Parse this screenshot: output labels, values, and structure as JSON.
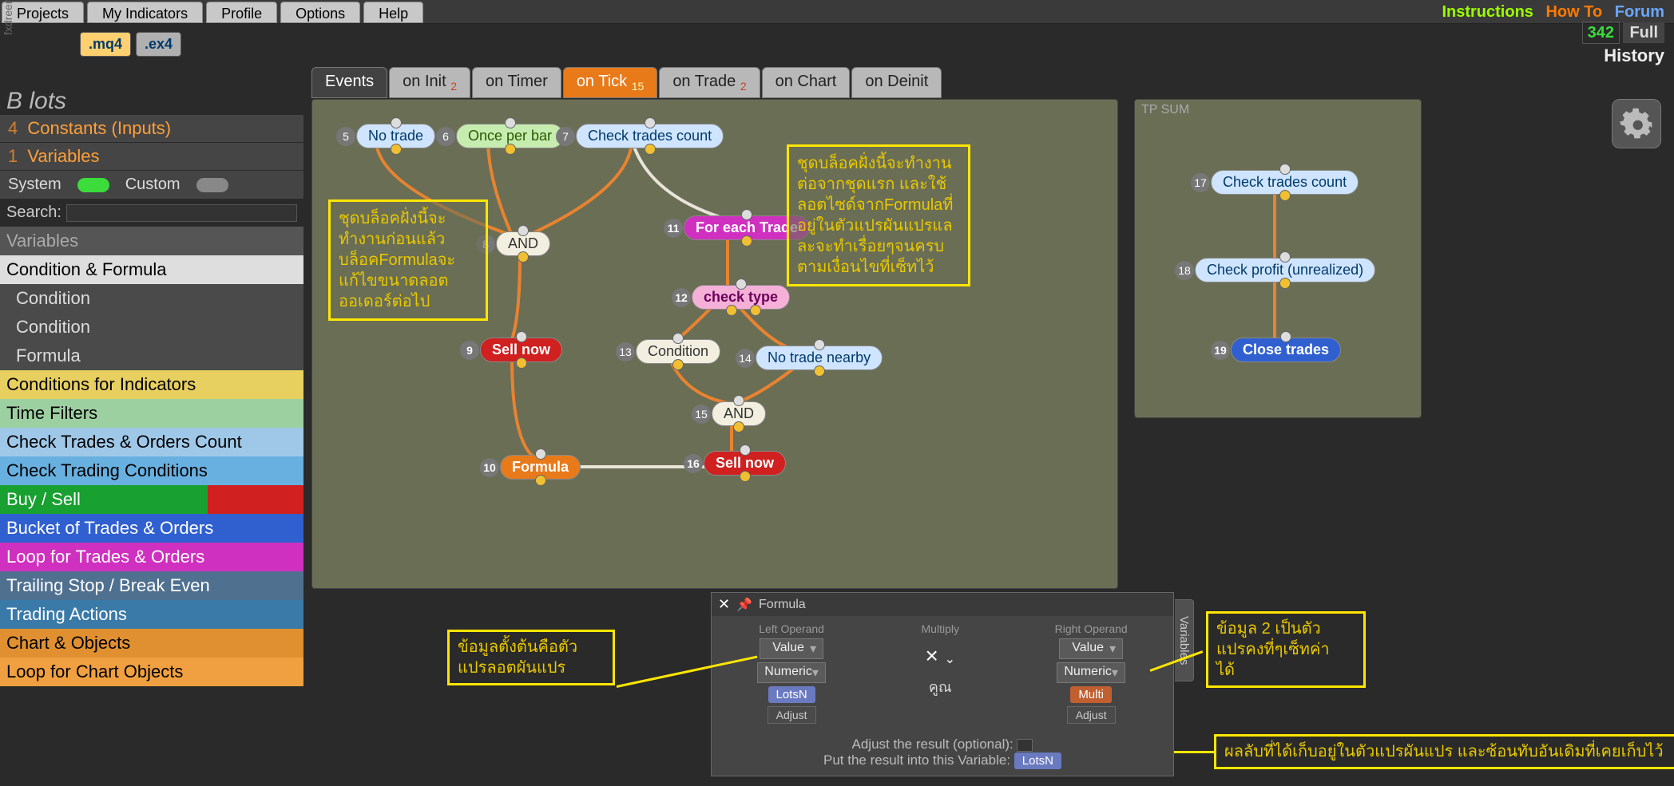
{
  "brand": "fxdreema",
  "menubar": [
    "Projects",
    "My Indicators",
    "Profile",
    "Options",
    "Help"
  ],
  "top_links": {
    "instructions": "Instructions",
    "howto": "How To",
    "forum": "Forum"
  },
  "row2": {
    "mq4": ".mq4",
    "ex4": ".ex4",
    "count": "342",
    "full": "Full",
    "history": "History"
  },
  "sidebar": {
    "title": "B lots",
    "constants_num": "4",
    "constants": "Constants (Inputs)",
    "variables_num": "1",
    "variables_label": "Variables",
    "system": "System",
    "custom": "Custom",
    "search_label": "Search:",
    "hdr_variables": "Variables",
    "categories": {
      "condform": "Condition & Formula",
      "sub1": "Condition",
      "sub2": "Condition",
      "sub3": "Formula",
      "condind": "Conditions for Indicators",
      "timefilt": "Time Filters",
      "checktrades": "Check Trades & Orders Count",
      "checkcond": "Check Trading Conditions",
      "buysell": "Buy / Sell",
      "bucket": "Bucket of Trades & Orders",
      "loop": "Loop for Trades & Orders",
      "trail": "Trailing Stop / Break Even",
      "actions": "Trading Actions",
      "chartobj": "Chart & Objects",
      "loopchart": "Loop for Chart Objects"
    }
  },
  "event_tabs": {
    "events": "Events",
    "init": "on Init",
    "init_sub": "2",
    "timer": "on Timer",
    "tick": "on Tick",
    "tick_sub": "15",
    "trade": "on Trade",
    "trade_sub": "2",
    "chart": "on Chart",
    "deinit": "on Deinit"
  },
  "panel_tpsum": "TP SUM",
  "nodes": {
    "n5": "No trade",
    "n6": "Once per bar",
    "n7": "Check trades count",
    "n8": "AND",
    "n9": "Sell now",
    "n10": "Formula",
    "n11": "For each Trade",
    "n12": "check type",
    "n13": "Condition",
    "n14": "No trade nearby",
    "n15": "AND",
    "n16": "Sell now",
    "n17": "Check trades count",
    "n18": "Check profit (unrealized)",
    "n19": "Close trades"
  },
  "notes": {
    "a": "ชุดบล็อคฝั่งนี้จะ\nทำงานก่อนแล้ว\nบล็อคFormulaจะ\nแก้ไขขนาดลอต\nออเดอร์ต่อไป",
    "b": "ชุดบล็อคฝั่งนี้จะทำงาน\nต่อจากชุดแรก และใช้\nลอตไซด์จากFormulaที่\nอยู่ในตัวแปรผันแปรแล\nละจะทำเรื่อยๆจนครบ\nตามเงื่อนไขที่เซ็ทไว้",
    "c": "ข้อมูลตั้งต้นคือตัว\nแปรลอตผันแปร",
    "d": "ข้อมูล 2 เป็นตัว\nแปรคงที่ๆเซ็ทค่า\nได้",
    "e": "ผลลับที่ได้เก็บอยู่ในตัวแปรผันแปร และซ้อนทับอันเดิมที่เคยเก็บไว้"
  },
  "formula_panel": {
    "title": "Formula",
    "side_tab": "Variables",
    "left_hdr": "Left Operand",
    "mult_hdr": "Multiply",
    "right_hdr": "Right Operand",
    "value": "Value",
    "numeric": "Numeric",
    "lotsn": "LotsN",
    "multi": "Multi",
    "adjust": "Adjust",
    "mult_thai": "คูณ",
    "adjust_label": "Adjust the result (optional):",
    "put_label": "Put the result into this Variable:",
    "put_var": "LotsN"
  }
}
